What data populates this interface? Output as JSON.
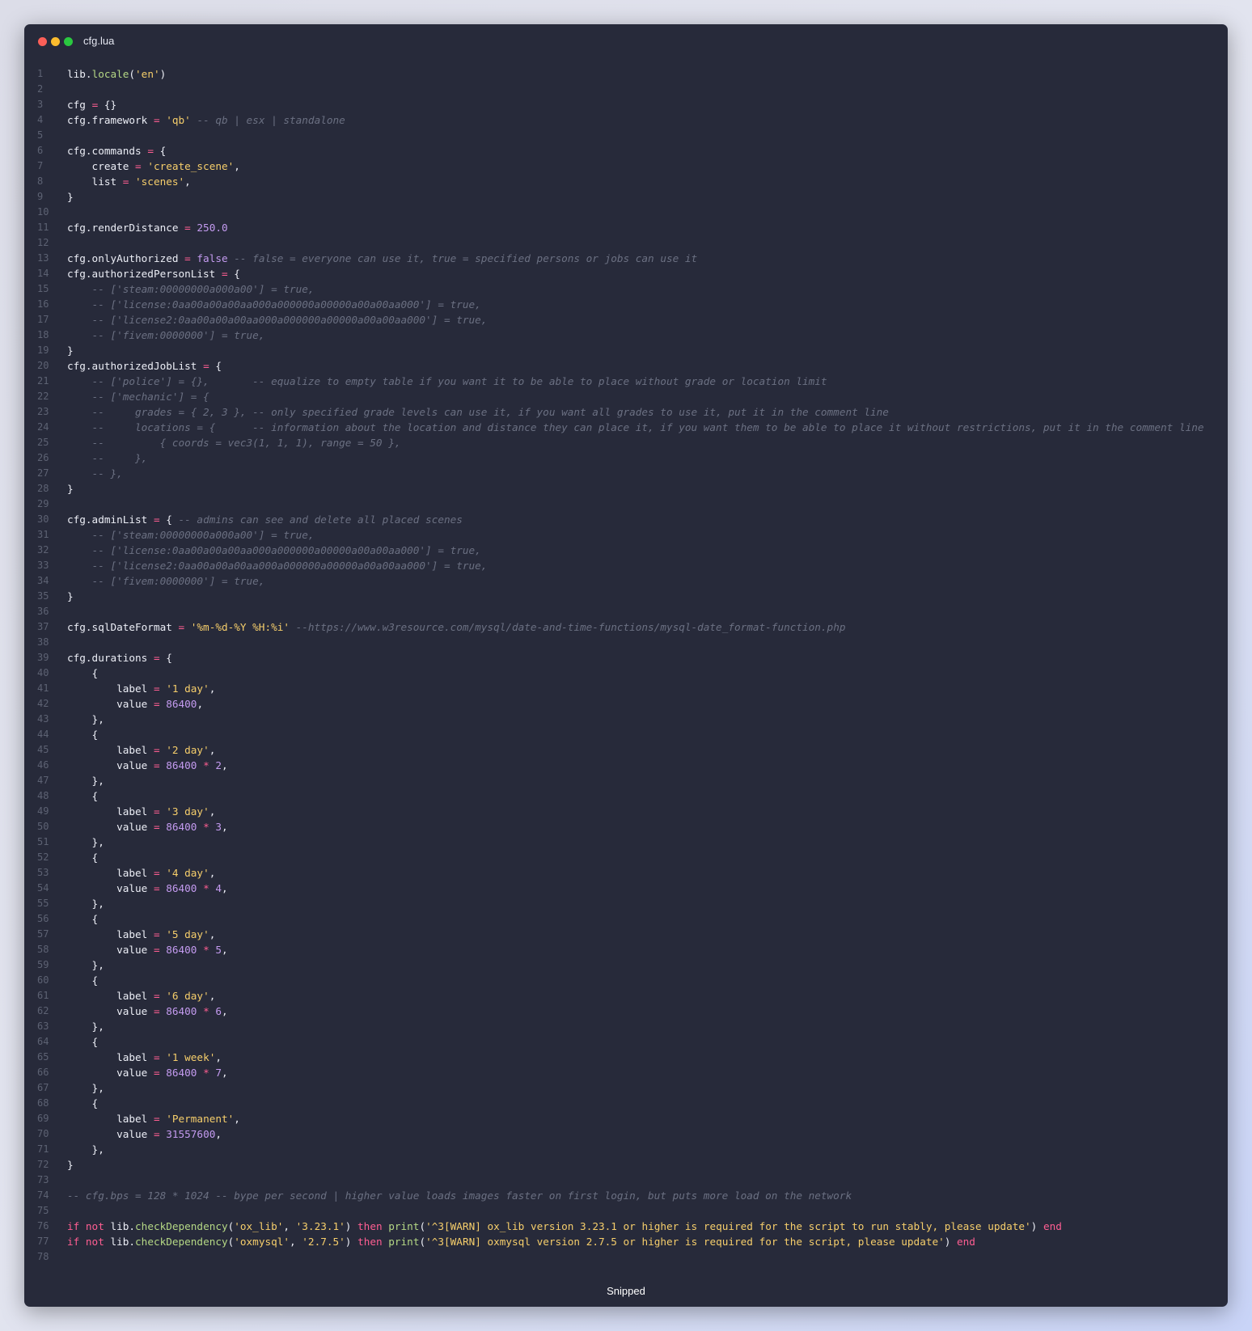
{
  "window": {
    "filename": "cfg.lua",
    "footer": "Snipped"
  },
  "colors": {
    "plain": "#eceef6",
    "function": "#b5d885",
    "string": "#f6ce6b",
    "operator": "#ff5e92",
    "number": "#c49bf0",
    "keyword": "#ff5e92",
    "comment": "#6b7082"
  },
  "lines": [
    [
      [
        "p",
        "lib."
      ],
      [
        "f",
        "locale"
      ],
      [
        "p",
        "("
      ],
      [
        "s",
        "'en'"
      ],
      [
        "p",
        ")"
      ]
    ],
    [],
    [
      [
        "p",
        "cfg "
      ],
      [
        "o",
        "="
      ],
      [
        "p",
        " {}"
      ]
    ],
    [
      [
        "p",
        "cfg.framework "
      ],
      [
        "o",
        "="
      ],
      [
        "p",
        " "
      ],
      [
        "s",
        "'qb'"
      ],
      [
        "p",
        " "
      ],
      [
        "c",
        "-- qb | esx | standalone"
      ]
    ],
    [],
    [
      [
        "p",
        "cfg.commands "
      ],
      [
        "o",
        "="
      ],
      [
        "p",
        " {"
      ]
    ],
    [
      [
        "p",
        "    create "
      ],
      [
        "o",
        "="
      ],
      [
        "p",
        " "
      ],
      [
        "s",
        "'create_scene'"
      ],
      [
        "p",
        ","
      ]
    ],
    [
      [
        "p",
        "    list "
      ],
      [
        "o",
        "="
      ],
      [
        "p",
        " "
      ],
      [
        "s",
        "'scenes'"
      ],
      [
        "p",
        ","
      ]
    ],
    [
      [
        "p",
        "}"
      ]
    ],
    [],
    [
      [
        "p",
        "cfg.renderDistance "
      ],
      [
        "o",
        "="
      ],
      [
        "p",
        " "
      ],
      [
        "n",
        "250.0"
      ]
    ],
    [],
    [
      [
        "p",
        "cfg.onlyAuthorized "
      ],
      [
        "o",
        "="
      ],
      [
        "p",
        " "
      ],
      [
        "n",
        "false"
      ],
      [
        "p",
        " "
      ],
      [
        "c",
        "-- false = everyone can use it, true = specified persons or jobs can use it"
      ]
    ],
    [
      [
        "p",
        "cfg.authorizedPersonList "
      ],
      [
        "o",
        "="
      ],
      [
        "p",
        " {"
      ]
    ],
    [
      [
        "p",
        "    "
      ],
      [
        "c",
        "-- ['steam:00000000a000a00'] = true,"
      ]
    ],
    [
      [
        "p",
        "    "
      ],
      [
        "c",
        "-- ['license:0aa00a00a00aa000a000000a00000a00a00aa000'] = true,"
      ]
    ],
    [
      [
        "p",
        "    "
      ],
      [
        "c",
        "-- ['license2:0aa00a00a00aa000a000000a00000a00a00aa000'] = true,"
      ]
    ],
    [
      [
        "p",
        "    "
      ],
      [
        "c",
        "-- ['fivem:0000000'] = true,"
      ]
    ],
    [
      [
        "p",
        "}"
      ]
    ],
    [
      [
        "p",
        "cfg.authorizedJobList "
      ],
      [
        "o",
        "="
      ],
      [
        "p",
        " {"
      ]
    ],
    [
      [
        "p",
        "    "
      ],
      [
        "c",
        "-- ['police'] = {},       -- equalize to empty table if you want it to be able to place without grade or location limit"
      ]
    ],
    [
      [
        "p",
        "    "
      ],
      [
        "c",
        "-- ['mechanic'] = {"
      ]
    ],
    [
      [
        "p",
        "    "
      ],
      [
        "c",
        "--     grades = { 2, 3 }, -- only specified grade levels can use it, if you want all grades to use it, put it in the comment line"
      ]
    ],
    [
      [
        "p",
        "    "
      ],
      [
        "c",
        "--     locations = {      -- information about the location and distance they can place it, if you want them to be able to place it without restrictions, put it in the comment line"
      ]
    ],
    [
      [
        "p",
        "    "
      ],
      [
        "c",
        "--         { coords = vec3(1, 1, 1), range = 50 },"
      ]
    ],
    [
      [
        "p",
        "    "
      ],
      [
        "c",
        "--     },"
      ]
    ],
    [
      [
        "p",
        "    "
      ],
      [
        "c",
        "-- },"
      ]
    ],
    [
      [
        "p",
        "}"
      ]
    ],
    [],
    [
      [
        "p",
        "cfg.adminList "
      ],
      [
        "o",
        "="
      ],
      [
        "p",
        " { "
      ],
      [
        "c",
        "-- admins can see and delete all placed scenes"
      ]
    ],
    [
      [
        "p",
        "    "
      ],
      [
        "c",
        "-- ['steam:00000000a000a00'] = true,"
      ]
    ],
    [
      [
        "p",
        "    "
      ],
      [
        "c",
        "-- ['license:0aa00a00a00aa000a000000a00000a00a00aa000'] = true,"
      ]
    ],
    [
      [
        "p",
        "    "
      ],
      [
        "c",
        "-- ['license2:0aa00a00a00aa000a000000a00000a00a00aa000'] = true,"
      ]
    ],
    [
      [
        "p",
        "    "
      ],
      [
        "c",
        "-- ['fivem:0000000'] = true,"
      ]
    ],
    [
      [
        "p",
        "}"
      ]
    ],
    [],
    [
      [
        "p",
        "cfg.sqlDateFormat "
      ],
      [
        "o",
        "="
      ],
      [
        "p",
        " "
      ],
      [
        "s",
        "'%m-%d-%Y %H:%i'"
      ],
      [
        "p",
        " "
      ],
      [
        "c",
        "--https://www.w3resource.com/mysql/date-and-time-functions/mysql-date_format-function.php"
      ]
    ],
    [],
    [
      [
        "p",
        "cfg.durations "
      ],
      [
        "o",
        "="
      ],
      [
        "p",
        " {"
      ]
    ],
    [
      [
        "p",
        "    {"
      ]
    ],
    [
      [
        "p",
        "        label "
      ],
      [
        "o",
        "="
      ],
      [
        "p",
        " "
      ],
      [
        "s",
        "'1 day'"
      ],
      [
        "p",
        ","
      ]
    ],
    [
      [
        "p",
        "        value "
      ],
      [
        "o",
        "="
      ],
      [
        "p",
        " "
      ],
      [
        "n",
        "86400"
      ],
      [
        "p",
        ","
      ]
    ],
    [
      [
        "p",
        "    },"
      ]
    ],
    [
      [
        "p",
        "    {"
      ]
    ],
    [
      [
        "p",
        "        label "
      ],
      [
        "o",
        "="
      ],
      [
        "p",
        " "
      ],
      [
        "s",
        "'2 day'"
      ],
      [
        "p",
        ","
      ]
    ],
    [
      [
        "p",
        "        value "
      ],
      [
        "o",
        "="
      ],
      [
        "p",
        " "
      ],
      [
        "n",
        "86400"
      ],
      [
        "p",
        " "
      ],
      [
        "o",
        "*"
      ],
      [
        "p",
        " "
      ],
      [
        "n",
        "2"
      ],
      [
        "p",
        ","
      ]
    ],
    [
      [
        "p",
        "    },"
      ]
    ],
    [
      [
        "p",
        "    {"
      ]
    ],
    [
      [
        "p",
        "        label "
      ],
      [
        "o",
        "="
      ],
      [
        "p",
        " "
      ],
      [
        "s",
        "'3 day'"
      ],
      [
        "p",
        ","
      ]
    ],
    [
      [
        "p",
        "        value "
      ],
      [
        "o",
        "="
      ],
      [
        "p",
        " "
      ],
      [
        "n",
        "86400"
      ],
      [
        "p",
        " "
      ],
      [
        "o",
        "*"
      ],
      [
        "p",
        " "
      ],
      [
        "n",
        "3"
      ],
      [
        "p",
        ","
      ]
    ],
    [
      [
        "p",
        "    },"
      ]
    ],
    [
      [
        "p",
        "    {"
      ]
    ],
    [
      [
        "p",
        "        label "
      ],
      [
        "o",
        "="
      ],
      [
        "p",
        " "
      ],
      [
        "s",
        "'4 day'"
      ],
      [
        "p",
        ","
      ]
    ],
    [
      [
        "p",
        "        value "
      ],
      [
        "o",
        "="
      ],
      [
        "p",
        " "
      ],
      [
        "n",
        "86400"
      ],
      [
        "p",
        " "
      ],
      [
        "o",
        "*"
      ],
      [
        "p",
        " "
      ],
      [
        "n",
        "4"
      ],
      [
        "p",
        ","
      ]
    ],
    [
      [
        "p",
        "    },"
      ]
    ],
    [
      [
        "p",
        "    {"
      ]
    ],
    [
      [
        "p",
        "        label "
      ],
      [
        "o",
        "="
      ],
      [
        "p",
        " "
      ],
      [
        "s",
        "'5 day'"
      ],
      [
        "p",
        ","
      ]
    ],
    [
      [
        "p",
        "        value "
      ],
      [
        "o",
        "="
      ],
      [
        "p",
        " "
      ],
      [
        "n",
        "86400"
      ],
      [
        "p",
        " "
      ],
      [
        "o",
        "*"
      ],
      [
        "p",
        " "
      ],
      [
        "n",
        "5"
      ],
      [
        "p",
        ","
      ]
    ],
    [
      [
        "p",
        "    },"
      ]
    ],
    [
      [
        "p",
        "    {"
      ]
    ],
    [
      [
        "p",
        "        label "
      ],
      [
        "o",
        "="
      ],
      [
        "p",
        " "
      ],
      [
        "s",
        "'6 day'"
      ],
      [
        "p",
        ","
      ]
    ],
    [
      [
        "p",
        "        value "
      ],
      [
        "o",
        "="
      ],
      [
        "p",
        " "
      ],
      [
        "n",
        "86400"
      ],
      [
        "p",
        " "
      ],
      [
        "o",
        "*"
      ],
      [
        "p",
        " "
      ],
      [
        "n",
        "6"
      ],
      [
        "p",
        ","
      ]
    ],
    [
      [
        "p",
        "    },"
      ]
    ],
    [
      [
        "p",
        "    {"
      ]
    ],
    [
      [
        "p",
        "        label "
      ],
      [
        "o",
        "="
      ],
      [
        "p",
        " "
      ],
      [
        "s",
        "'1 week'"
      ],
      [
        "p",
        ","
      ]
    ],
    [
      [
        "p",
        "        value "
      ],
      [
        "o",
        "="
      ],
      [
        "p",
        " "
      ],
      [
        "n",
        "86400"
      ],
      [
        "p",
        " "
      ],
      [
        "o",
        "*"
      ],
      [
        "p",
        " "
      ],
      [
        "n",
        "7"
      ],
      [
        "p",
        ","
      ]
    ],
    [
      [
        "p",
        "    },"
      ]
    ],
    [
      [
        "p",
        "    {"
      ]
    ],
    [
      [
        "p",
        "        label "
      ],
      [
        "o",
        "="
      ],
      [
        "p",
        " "
      ],
      [
        "s",
        "'Permanent'"
      ],
      [
        "p",
        ","
      ]
    ],
    [
      [
        "p",
        "        value "
      ],
      [
        "o",
        "="
      ],
      [
        "p",
        " "
      ],
      [
        "n",
        "31557600"
      ],
      [
        "p",
        ","
      ]
    ],
    [
      [
        "p",
        "    },"
      ]
    ],
    [
      [
        "p",
        "}"
      ]
    ],
    [],
    [
      [
        "c",
        "-- cfg.bps = 128 * 1024 -- bype per second | higher value loads images faster on first login, but puts more load on the network"
      ]
    ],
    [],
    [
      [
        "k",
        "if not"
      ],
      [
        "p",
        " lib."
      ],
      [
        "f",
        "checkDependency"
      ],
      [
        "p",
        "("
      ],
      [
        "s",
        "'ox_lib'"
      ],
      [
        "p",
        ", "
      ],
      [
        "s",
        "'3.23.1'"
      ],
      [
        "p",
        ") "
      ],
      [
        "k",
        "then"
      ],
      [
        "p",
        " "
      ],
      [
        "f",
        "print"
      ],
      [
        "p",
        "("
      ],
      [
        "s",
        "'^3[WARN] ox_lib version 3.23.1 or higher is required for the script to run stably, please update'"
      ],
      [
        "p",
        ") "
      ],
      [
        "k",
        "end"
      ]
    ],
    [
      [
        "k",
        "if not"
      ],
      [
        "p",
        " lib."
      ],
      [
        "f",
        "checkDependency"
      ],
      [
        "p",
        "("
      ],
      [
        "s",
        "'oxmysql'"
      ],
      [
        "p",
        ", "
      ],
      [
        "s",
        "'2.7.5'"
      ],
      [
        "p",
        ") "
      ],
      [
        "k",
        "then"
      ],
      [
        "p",
        " "
      ],
      [
        "f",
        "print"
      ],
      [
        "p",
        "("
      ],
      [
        "s",
        "'^3[WARN] oxmysql version 2.7.5 or higher is required for the script, please update'"
      ],
      [
        "p",
        ") "
      ],
      [
        "k",
        "end"
      ]
    ],
    []
  ]
}
